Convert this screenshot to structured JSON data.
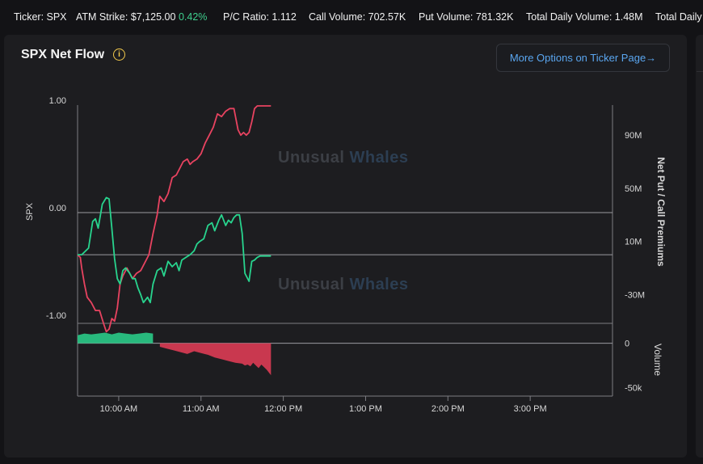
{
  "ticker_bar": {
    "ticker": "Ticker: SPX",
    "atm_label": "ATM Strike:",
    "atm_value": "$7,125.00",
    "atm_change": "0.42%",
    "pc_ratio": "P/C Ratio: 1.112",
    "call_volume": "Call Volume: 702.57K",
    "put_volume": "Put Volume: 781.32K",
    "total_daily_volume": "Total Daily Volume: 1.48M",
    "total_daily_more": "Total Daily"
  },
  "panel": {
    "title": "SPX Net Flow",
    "more_button": "More Options on Ticker Page",
    "more_arrow": "→",
    "watermark_a": "Unusual",
    "watermark_b": "Whales"
  },
  "colors": {
    "call_line": "#28d48e",
    "put_line": "#e84360",
    "volume_positive": "#28b97d",
    "volume_negative": "#c9384f",
    "accent_link": "#5aa6f0"
  },
  "chart_data": {
    "type": "line",
    "left_axis": {
      "label": "SPX",
      "ticks": [
        "1.00",
        "0.00",
        "-1.00"
      ],
      "ylim": [
        -1,
        1
      ]
    },
    "right_axis": {
      "label": "Net Put / Call Premiums",
      "ticks": [
        "90M",
        "50M",
        "10M",
        "-30M"
      ],
      "ylim": [
        -48,
        112
      ]
    },
    "volume_axis": {
      "label": "Volume",
      "ticks": [
        "0",
        "-50k"
      ],
      "ylim": [
        -55,
        17
      ]
    },
    "x_axis": {
      "ticks": [
        "10:00 AM",
        "11:00 AM",
        "12:00 PM",
        "1:00 PM",
        "2:00 PM",
        "3:00 PM"
      ]
    },
    "x_range_minutes": [
      570,
      960
    ],
    "series": [
      {
        "key": "call",
        "x": [
          570,
          573,
          576,
          578,
          581,
          583,
          585,
          588,
          591,
          593,
          595,
          597,
          599,
          601,
          603,
          605,
          608,
          610,
          612,
          614,
          616,
          618,
          621,
          623,
          625,
          628,
          631,
          633,
          636,
          639,
          642,
          644,
          646,
          649,
          652,
          655,
          657,
          659,
          662,
          665,
          668,
          670,
          673,
          675,
          678,
          680,
          682,
          684,
          686,
          688,
          690,
          692,
          695,
          697,
          699,
          701,
          703,
          705,
          707,
          709,
          711
        ],
        "y": [
          0,
          0,
          3,
          5,
          25,
          27,
          20,
          38,
          43,
          42,
          20,
          -3,
          -18,
          -22,
          -12,
          -10,
          -14,
          -18,
          -18,
          -25,
          -30,
          -36,
          -32,
          -36,
          -22,
          -12,
          -10,
          -16,
          -5,
          -9,
          -6,
          -12,
          -4,
          -2,
          0,
          3,
          8,
          10,
          12,
          22,
          24,
          18,
          26,
          30,
          22,
          26,
          24,
          28,
          30,
          30,
          16,
          -14,
          -20,
          -5,
          -4,
          -2,
          -1,
          -1,
          -1,
          -1,
          -1
        ]
      },
      {
        "key": "put",
        "x": [
          570,
          572,
          573,
          575,
          577,
          580,
          583,
          586,
          589,
          591,
          593,
          595,
          597,
          599,
          601,
          603,
          605,
          606,
          608,
          610,
          613,
          616,
          619,
          622,
          625,
          628,
          630,
          633,
          636,
          639,
          642,
          645,
          647,
          650,
          652,
          654,
          657,
          660,
          663,
          666,
          669,
          672,
          675,
          678,
          681,
          684,
          687,
          689,
          691,
          693,
          695,
          697,
          699,
          701,
          703,
          705,
          707,
          709,
          711
        ],
        "y": [
          0,
          -2,
          -10,
          -22,
          -32,
          -36,
          -42,
          -42,
          -52,
          -58,
          -56,
          -48,
          -50,
          -40,
          -22,
          -16,
          -12,
          -10,
          -14,
          -18,
          -14,
          -12,
          -6,
          0,
          16,
          30,
          44,
          40,
          46,
          58,
          60,
          66,
          70,
          72,
          68,
          70,
          72,
          76,
          84,
          90,
          96,
          106,
          104,
          108,
          110,
          110,
          94,
          90,
          92,
          90,
          92,
          100,
          110,
          112,
          112,
          112,
          112,
          112,
          112
        ]
      },
      {
        "key": "volume",
        "x": [
          570,
          575,
          580,
          585,
          590,
          595,
          600,
          605,
          610,
          615,
          620,
          625,
          630,
          635,
          640,
          645,
          650,
          655,
          660,
          665,
          670,
          675,
          680,
          685,
          690,
          692,
          694,
          696,
          698,
          700,
          702,
          704,
          706,
          708,
          710,
          711
        ],
        "y": [
          9,
          11,
          10,
          11,
          12,
          10,
          12,
          11,
          10,
          11,
          12,
          11,
          -4,
          -6,
          -8,
          -10,
          -12,
          -9,
          -11,
          -13,
          -16,
          -18,
          -20,
          -22,
          -23,
          -25,
          -24,
          -26,
          -22,
          -25,
          -28,
          -24,
          -27,
          -30,
          -34,
          -36
        ]
      }
    ]
  }
}
